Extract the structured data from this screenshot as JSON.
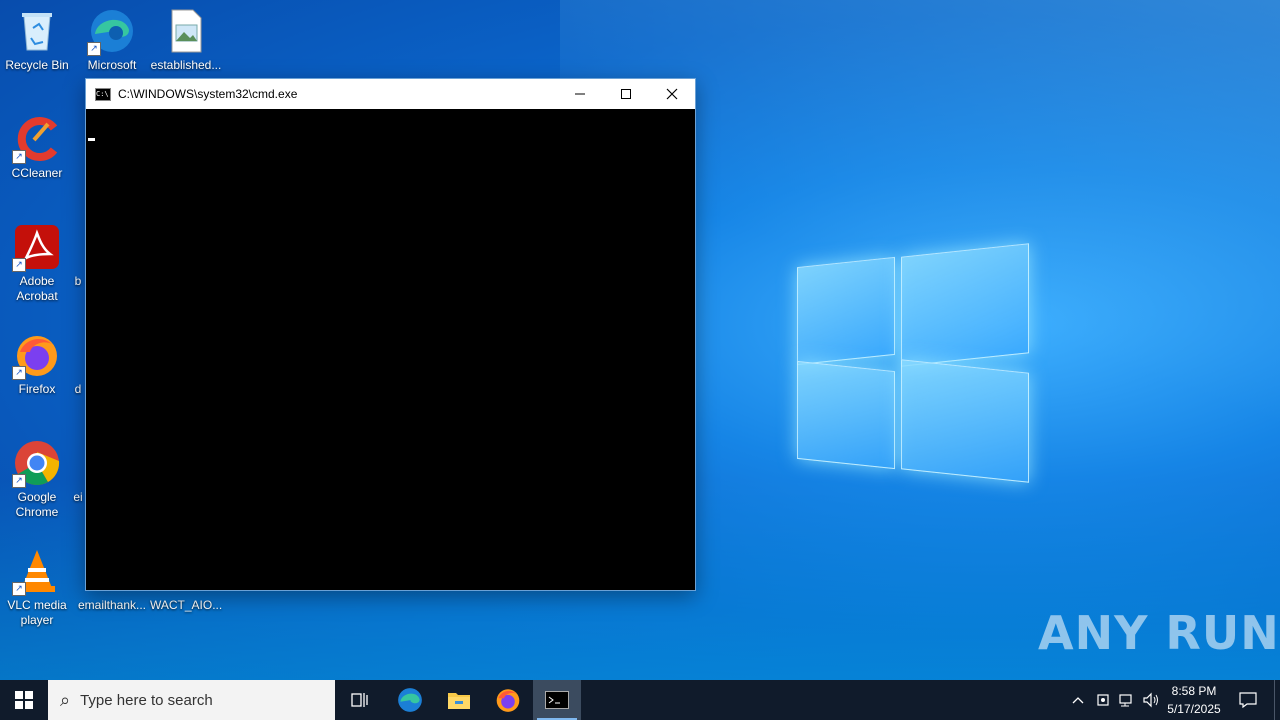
{
  "desktop_icons": [
    {
      "label": "Recycle Bin"
    },
    {
      "label": "Microsoft Edge"
    },
    {
      "label": "established..."
    },
    {
      "label": "CCleaner"
    },
    {
      "label": "Adobe Acrobat"
    },
    {
      "label": "Firefox"
    },
    {
      "label": "Google Chrome"
    },
    {
      "label": "VLC media player"
    },
    {
      "label": "emailthank..."
    },
    {
      "label": "WACT_AIO..."
    }
  ],
  "partial_icon_labels": [
    "b",
    "d",
    "ei"
  ],
  "cmd_window": {
    "title": "C:\\WINDOWS\\system32\\cmd.exe",
    "icon_text": "C:\\"
  },
  "taskbar": {
    "search_placeholder": "Type here to search",
    "clock_time": "8:58 PM",
    "clock_date": "5/17/2025"
  },
  "watermark": "ANY RUN",
  "colors": {
    "taskbar_bg": "#101b2b",
    "console_bg": "#000000",
    "accent": "#0a63c8"
  }
}
